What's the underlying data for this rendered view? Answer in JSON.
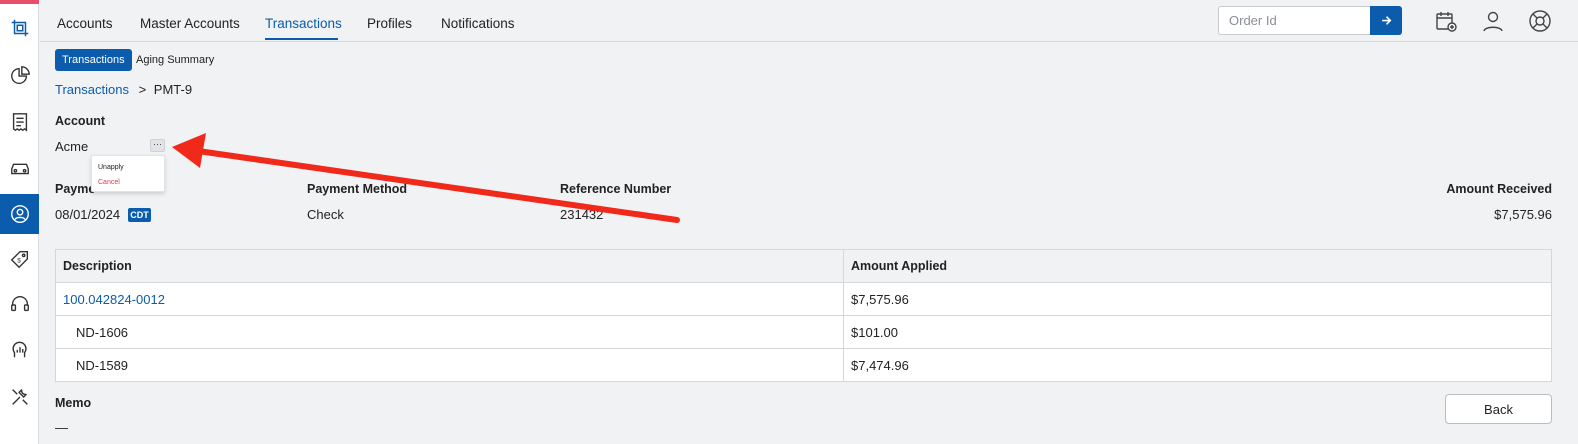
{
  "sidebar": {
    "items": [
      {
        "icon": "logo-icon"
      },
      {
        "icon": "pie-chart-icon"
      },
      {
        "icon": "receipt-icon"
      },
      {
        "icon": "car-icon"
      },
      {
        "icon": "user-circle-icon",
        "active": true
      },
      {
        "icon": "price-tag-icon"
      },
      {
        "icon": "headset-icon"
      },
      {
        "icon": "analytics-head-icon"
      },
      {
        "icon": "tools-icon"
      }
    ],
    "accent": "#0b5cad",
    "top_stripe": "#e8506a"
  },
  "topnav": {
    "tabs": [
      "Accounts",
      "Master Accounts",
      "Transactions",
      "Profiles",
      "Notifications"
    ],
    "active_tab": "Transactions",
    "order_placeholder": "Order Id"
  },
  "subtabs": [
    "Transactions",
    "Aging Summary"
  ],
  "breadcrumb": {
    "link": "Transactions",
    "sep": ">",
    "current": "PMT-9"
  },
  "account": {
    "label": "Account",
    "value": "Acme"
  },
  "menu": {
    "unapply": "Unapply",
    "cancel": "Cancel"
  },
  "payment": {
    "date_label": "Payme",
    "date": "08/01/2024",
    "badge": "CDT",
    "method_label": "Payment Method",
    "method": "Check",
    "ref_label": "Reference Number",
    "ref": "231432",
    "amount_label": "Amount Received",
    "amount": "$7,575.96"
  },
  "table": {
    "headers": [
      "Description",
      "Amount Applied"
    ],
    "rows": [
      {
        "desc": "100.042824-0012",
        "amount": "$7,575.96"
      },
      {
        "desc": "ND-1606",
        "amount": "$101.00"
      },
      {
        "desc": "ND-1589",
        "amount": "$7,474.96"
      }
    ]
  },
  "memo": {
    "label": "Memo",
    "value": "—"
  },
  "back_label": "Back",
  "colors": {
    "primary": "#0b5cad",
    "danger": "#e0364a",
    "annotation_arrow": "#f0291b"
  }
}
